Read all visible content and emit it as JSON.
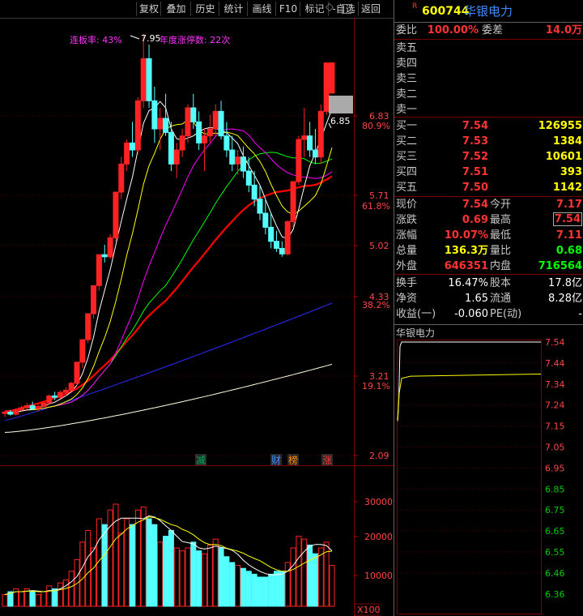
{
  "toolbar": {
    "buttons": [
      "复权",
      "叠加",
      "历史",
      "统计",
      "画线",
      "F10",
      "标记",
      "-自选",
      "返回"
    ]
  },
  "annotations": {
    "limit_rate": "连板率: 43%",
    "peak_price": "7.95",
    "annual_limits": "年度涨停数: 22次",
    "last_price_tag": "6.85",
    "badge_jian": "减",
    "badge_cai": "财",
    "badge_bang": "榜",
    "badge_zhang": "涨"
  },
  "price_axis": [
    {
      "v": "6.83",
      "p": ""
    },
    {
      "v": "",
      "p": "80.9%"
    },
    {
      "v": "5.71",
      "p": "61.8%"
    },
    {
      "v": "5.02",
      "p": ""
    },
    {
      "v": "4.33",
      "p": "38.2%"
    },
    {
      "v": "3.21",
      "p": "19.1%"
    },
    {
      "v": "2.09",
      "p": ""
    }
  ],
  "volume_axis": [
    "30000",
    "20000",
    "10000",
    "X100"
  ],
  "stock": {
    "flag": "R",
    "code": "600744",
    "name": "华银电力"
  },
  "order_book": {
    "ratio_label": "委比",
    "ratio": "100.00%",
    "diff_label": "委差",
    "diff": "14.0万",
    "sells": [
      "卖五",
      "卖四",
      "卖三",
      "卖二",
      "卖一"
    ],
    "buys": [
      {
        "label": "买一",
        "price": "7.54",
        "vol": "126955"
      },
      {
        "label": "买二",
        "price": "7.53",
        "vol": "1384"
      },
      {
        "label": "买三",
        "price": "7.52",
        "vol": "10601"
      },
      {
        "label": "买四",
        "price": "7.51",
        "vol": "393"
      },
      {
        "label": "买五",
        "price": "7.50",
        "vol": "1142"
      }
    ]
  },
  "quote": [
    {
      "l1": "现价",
      "v1": "7.54",
      "l2": "今开",
      "v2": "7.17"
    },
    {
      "l1": "涨跌",
      "v1": "0.69",
      "l2": "最高",
      "v2": "7.54"
    },
    {
      "l1": "涨幅",
      "v1": "10.07%",
      "l2": "最低",
      "v2": "7.11"
    },
    {
      "l1": "总量",
      "v1": "136.3万",
      "l2": "量比",
      "v2": "0.68"
    },
    {
      "l1": "外盘",
      "v1": "646351",
      "l2": "内盘",
      "v2": "716564"
    }
  ],
  "finance": [
    {
      "l1": "换手",
      "v1": "16.47%",
      "l2": "股本",
      "v2": "17.8亿"
    },
    {
      "l1": "净资",
      "v1": "1.65",
      "l2": "流通",
      "v2": "8.28亿"
    },
    {
      "l1": "收益(一)",
      "v1": "-0.060",
      "l2": "PE(动)",
      "v2": "-"
    }
  ],
  "intraday": {
    "title": "华银电力",
    "axis": [
      "7.54",
      "7.44",
      "7.34",
      "7.24",
      "7.15",
      "7.05",
      "6.95",
      "6.85",
      "6.75",
      "6.65",
      "6.55",
      "6.46",
      "6.36"
    ]
  },
  "colors": {
    "up": "#ff2222",
    "down": "#54ffff",
    "ma5": "#ffffff",
    "ma10": "#ffff00",
    "ma20": "#ff00ff",
    "ma30": "#00ff00",
    "ma60": "#ff0000",
    "ma120": "#2b2bff",
    "ma250": "#ffffe0"
  },
  "chart_data": {
    "type": "candlestick",
    "price_range": [
      2.09,
      7.95
    ],
    "candles": [
      [
        2.55,
        2.58,
        2.5,
        2.57
      ],
      [
        2.57,
        2.6,
        2.52,
        2.54
      ],
      [
        2.54,
        2.62,
        2.52,
        2.6
      ],
      [
        2.6,
        2.66,
        2.58,
        2.63
      ],
      [
        2.63,
        2.7,
        2.6,
        2.66
      ],
      [
        2.66,
        2.72,
        2.6,
        2.62
      ],
      [
        2.62,
        2.68,
        2.58,
        2.65
      ],
      [
        2.65,
        2.72,
        2.62,
        2.7
      ],
      [
        2.7,
        2.82,
        2.68,
        2.8
      ],
      [
        2.8,
        2.86,
        2.74,
        2.78
      ],
      [
        2.78,
        2.88,
        2.76,
        2.85
      ],
      [
        2.85,
        2.92,
        2.8,
        2.88
      ],
      [
        2.88,
        3.0,
        2.86,
        2.98
      ],
      [
        2.98,
        3.28,
        2.95,
        3.28
      ],
      [
        3.28,
        3.6,
        3.2,
        3.6
      ],
      [
        3.6,
        3.97,
        3.55,
        3.97
      ],
      [
        3.97,
        4.37,
        3.9,
        4.37
      ],
      [
        4.37,
        4.81,
        4.3,
        4.81
      ],
      [
        4.81,
        4.95,
        4.7,
        4.78
      ],
      [
        4.78,
        5.1,
        4.75,
        5.05
      ],
      [
        5.05,
        5.7,
        5.0,
        5.7
      ],
      [
        5.7,
        6.2,
        5.6,
        6.1
      ],
      [
        6.1,
        6.45,
        6.0,
        6.4
      ],
      [
        6.4,
        6.7,
        6.2,
        6.3
      ],
      [
        6.3,
        7.05,
        6.25,
        7.0
      ],
      [
        7.0,
        7.95,
        6.9,
        7.6
      ],
      [
        7.6,
        7.8,
        6.9,
        7.0
      ],
      [
        7.0,
        7.2,
        6.4,
        6.6
      ],
      [
        6.6,
        6.9,
        6.3,
        6.75
      ],
      [
        6.75,
        7.1,
        6.5,
        6.55
      ],
      [
        6.55,
        6.7,
        6.0,
        6.1
      ],
      [
        6.1,
        6.4,
        5.9,
        6.3
      ],
      [
        6.3,
        6.6,
        6.2,
        6.5
      ],
      [
        6.5,
        6.95,
        6.4,
        6.9
      ],
      [
        6.9,
        7.1,
        6.6,
        6.7
      ],
      [
        6.7,
        6.85,
        6.3,
        6.4
      ],
      [
        6.4,
        6.6,
        6.0,
        6.5
      ],
      [
        6.5,
        6.8,
        6.4,
        6.6
      ],
      [
        6.6,
        6.95,
        6.5,
        6.85
      ],
      [
        6.85,
        7.0,
        6.45,
        6.5
      ],
      [
        6.5,
        6.7,
        6.2,
        6.3
      ],
      [
        6.3,
        6.5,
        6.0,
        6.1
      ],
      [
        6.1,
        6.3,
        5.95,
        6.2
      ],
      [
        6.2,
        6.35,
        5.9,
        6.0
      ],
      [
        6.0,
        6.2,
        5.7,
        5.8
      ],
      [
        5.8,
        6.0,
        5.5,
        5.6
      ],
      [
        5.6,
        5.8,
        5.3,
        5.4
      ],
      [
        5.4,
        5.6,
        5.1,
        5.2
      ],
      [
        5.2,
        5.4,
        4.9,
        5.0
      ],
      [
        5.0,
        5.15,
        4.85,
        4.9
      ],
      [
        4.9,
        5.0,
        4.78,
        4.82
      ],
      [
        4.82,
        5.3,
        4.8,
        5.28
      ],
      [
        5.28,
        5.85,
        5.2,
        5.85
      ],
      [
        5.85,
        6.5,
        5.8,
        6.45
      ],
      [
        6.45,
        6.9,
        6.2,
        6.5
      ],
      [
        6.5,
        6.7,
        6.2,
        6.3
      ],
      [
        6.3,
        6.6,
        6.1,
        6.2
      ],
      [
        6.2,
        6.95,
        6.1,
        6.85
      ],
      [
        6.85,
        7.54,
        6.8,
        7.54
      ],
      [
        7.11,
        7.54,
        7.11,
        7.54
      ]
    ],
    "volumes": [
      4,
      5,
      6,
      5,
      6,
      5,
      4,
      5,
      7,
      6,
      8,
      9,
      12,
      16,
      22,
      26,
      20,
      30,
      28,
      33,
      35,
      25,
      30,
      28,
      33,
      34,
      30,
      28,
      22,
      24,
      26,
      20,
      19,
      20,
      22,
      19,
      18,
      21,
      23,
      20,
      17,
      15,
      14,
      13,
      12,
      11,
      10,
      10,
      11,
      12,
      12,
      15,
      20,
      24,
      23,
      21,
      18,
      20,
      22,
      14
    ],
    "ma_series": [
      "ma5",
      "ma10",
      "ma20",
      "ma30",
      "ma60",
      "ma120",
      "ma250"
    ]
  }
}
